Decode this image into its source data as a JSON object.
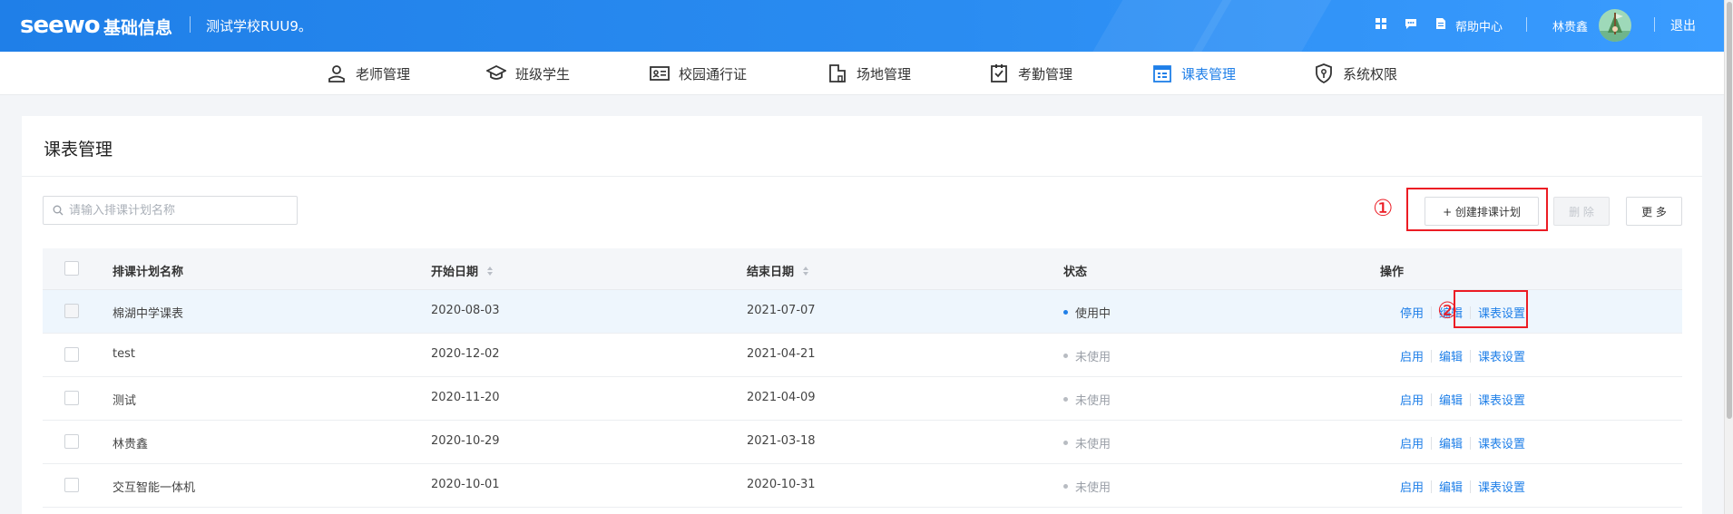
{
  "header": {
    "logo": "seewo",
    "app_name": "基础信息",
    "school": "测试学校RUU9。",
    "help_label": "帮助中心",
    "user_name": "林贵鑫",
    "logout_label": "退出"
  },
  "nav": {
    "items": [
      {
        "label": "老师管理",
        "icon": "person-icon"
      },
      {
        "label": "班级学生",
        "icon": "graduation-cap-icon"
      },
      {
        "label": "校园通行证",
        "icon": "id-card-icon"
      },
      {
        "label": "场地管理",
        "icon": "building-icon"
      },
      {
        "label": "考勤管理",
        "icon": "checklist-icon"
      },
      {
        "label": "课表管理",
        "icon": "calendar-icon",
        "active": true
      },
      {
        "label": "系统权限",
        "icon": "shield-icon"
      }
    ]
  },
  "page": {
    "title": "课表管理",
    "search_placeholder": "请输入排课计划名称",
    "create_button": "+ 创建排课计划",
    "delete_button": "删 除",
    "more_button": "更 多",
    "annotation_1": "①",
    "annotation_2": "②"
  },
  "table": {
    "columns": [
      "排课计划名称",
      "开始日期",
      "结束日期",
      "状态",
      "操作"
    ],
    "rows": [
      {
        "name": "棉湖中学课表",
        "start": "2020-08-03",
        "end": "2021-07-07",
        "status": "使用中",
        "active": true,
        "toggle": "停用",
        "edit": "编辑",
        "settings": "课表设置"
      },
      {
        "name": "test",
        "start": "2020-12-02",
        "end": "2021-04-21",
        "status": "未使用",
        "active": false,
        "toggle": "启用",
        "edit": "编辑",
        "settings": "课表设置"
      },
      {
        "name": "测试",
        "start": "2020-11-20",
        "end": "2021-04-09",
        "status": "未使用",
        "active": false,
        "toggle": "启用",
        "edit": "编辑",
        "settings": "课表设置"
      },
      {
        "name": "林贵鑫",
        "start": "2020-10-29",
        "end": "2021-03-18",
        "status": "未使用",
        "active": false,
        "toggle": "启用",
        "edit": "编辑",
        "settings": "课表设置"
      },
      {
        "name": "交互智能一体机",
        "start": "2020-10-01",
        "end": "2020-10-31",
        "status": "未使用",
        "active": false,
        "toggle": "启用",
        "edit": "编辑",
        "settings": "课表设置"
      }
    ]
  },
  "colors": {
    "brand": "#1f7fe8",
    "annotation": "#ec1c24"
  }
}
